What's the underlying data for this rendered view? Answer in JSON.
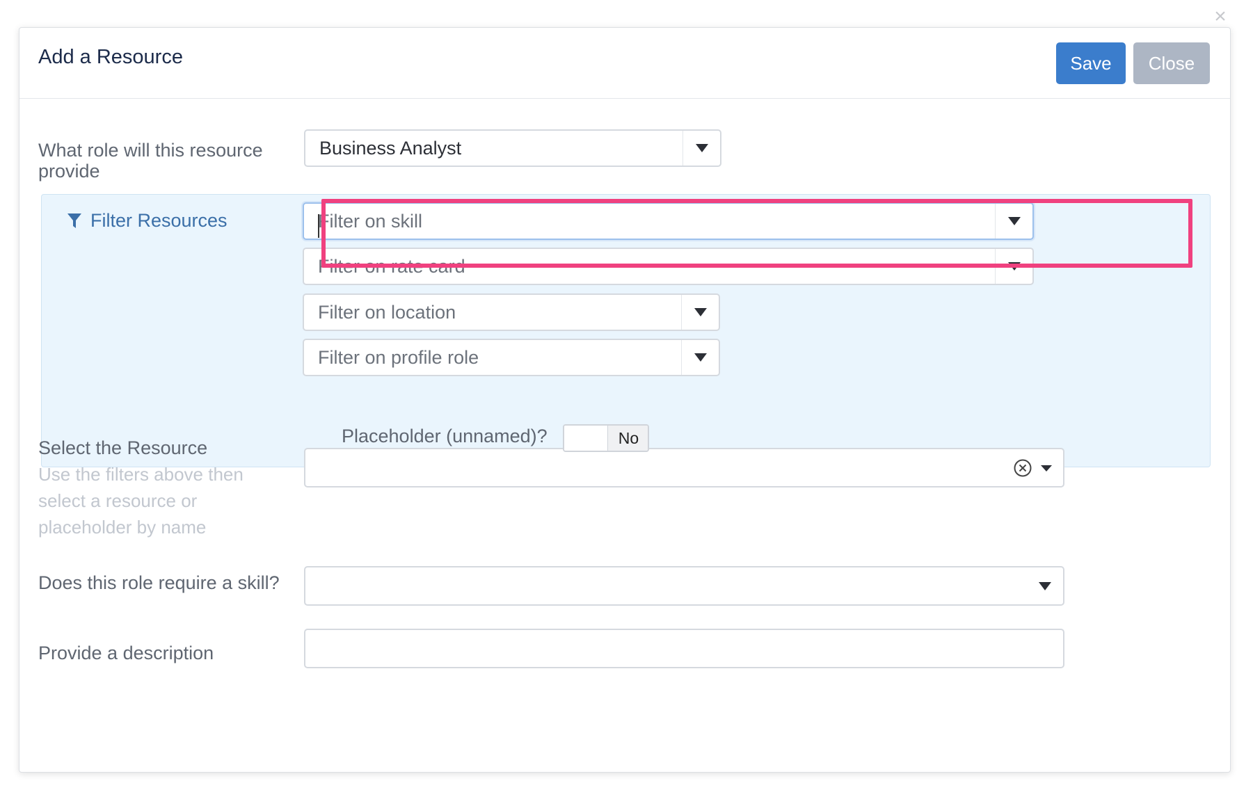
{
  "dialog": {
    "title": "Add a Resource",
    "save_label": "Save",
    "close_label": "Close"
  },
  "role": {
    "label": "What role will this resource provide",
    "value": "Business Analyst"
  },
  "filters": {
    "title": "Filter Resources",
    "skill_placeholder": "Filter on skill",
    "rate_card_placeholder": "Filter on rate card",
    "location_placeholder": "Filter on location",
    "profile_role_placeholder": "Filter on profile role",
    "placeholder_label": "Placeholder (unnamed)?",
    "placeholder_value": "No"
  },
  "resource": {
    "label": "Select the Resource",
    "hint": "Use the filters above then select a resource or placeholder by name",
    "value": ""
  },
  "skill_required": {
    "label": "Does this role require a skill?",
    "value": ""
  },
  "description": {
    "label": "Provide a description",
    "value": ""
  },
  "colors": {
    "accent": "#3b7dcc",
    "highlight": "#f0417f",
    "panel": "#eaf5fd"
  },
  "icons": [
    "close-icon",
    "filter-icon",
    "caret-down-icon",
    "clear-icon"
  ]
}
